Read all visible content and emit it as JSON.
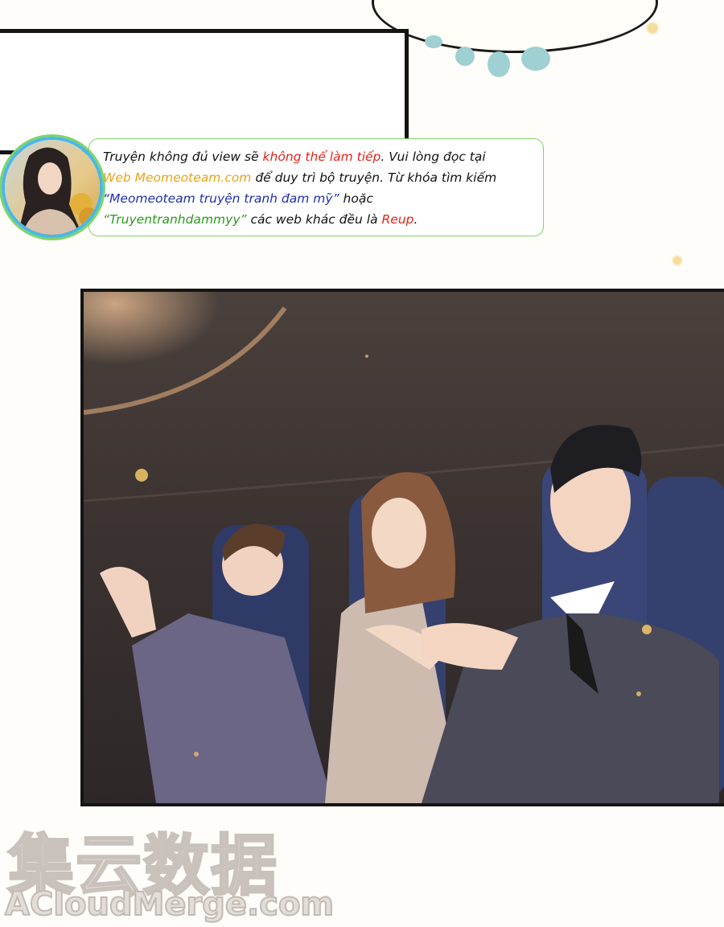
{
  "notice": {
    "line1_a": "Truyện không đủ view sẽ ",
    "line1_b": "không thể làm tiếp",
    "line1_c": ". Vui lòng đọc tại",
    "line2_a": "Web Meomeoteam.com",
    "line2_b": " để duy trì bộ truyện. Từ khóa tìm kiếm",
    "line3_a": "“Meomeoteam truyện tranh đam mỹ”",
    "line3_b": " hoặc",
    "line4_a": "“Truyentranhdammyy”",
    "line4_b": " các web khác đều là ",
    "line4_c": "Reup",
    "line4_d": "."
  },
  "watermark": {
    "chinese": "集云数据",
    "latin": "ACloudMerge.com"
  },
  "colors": {
    "highlight_red": "#e0241b",
    "highlight_orange": "#e7a317",
    "highlight_blue": "#1f2fb0",
    "highlight_green": "#2c9a1c",
    "notice_border": "#7fd46a",
    "avatar_ring": "#48b8e8"
  }
}
